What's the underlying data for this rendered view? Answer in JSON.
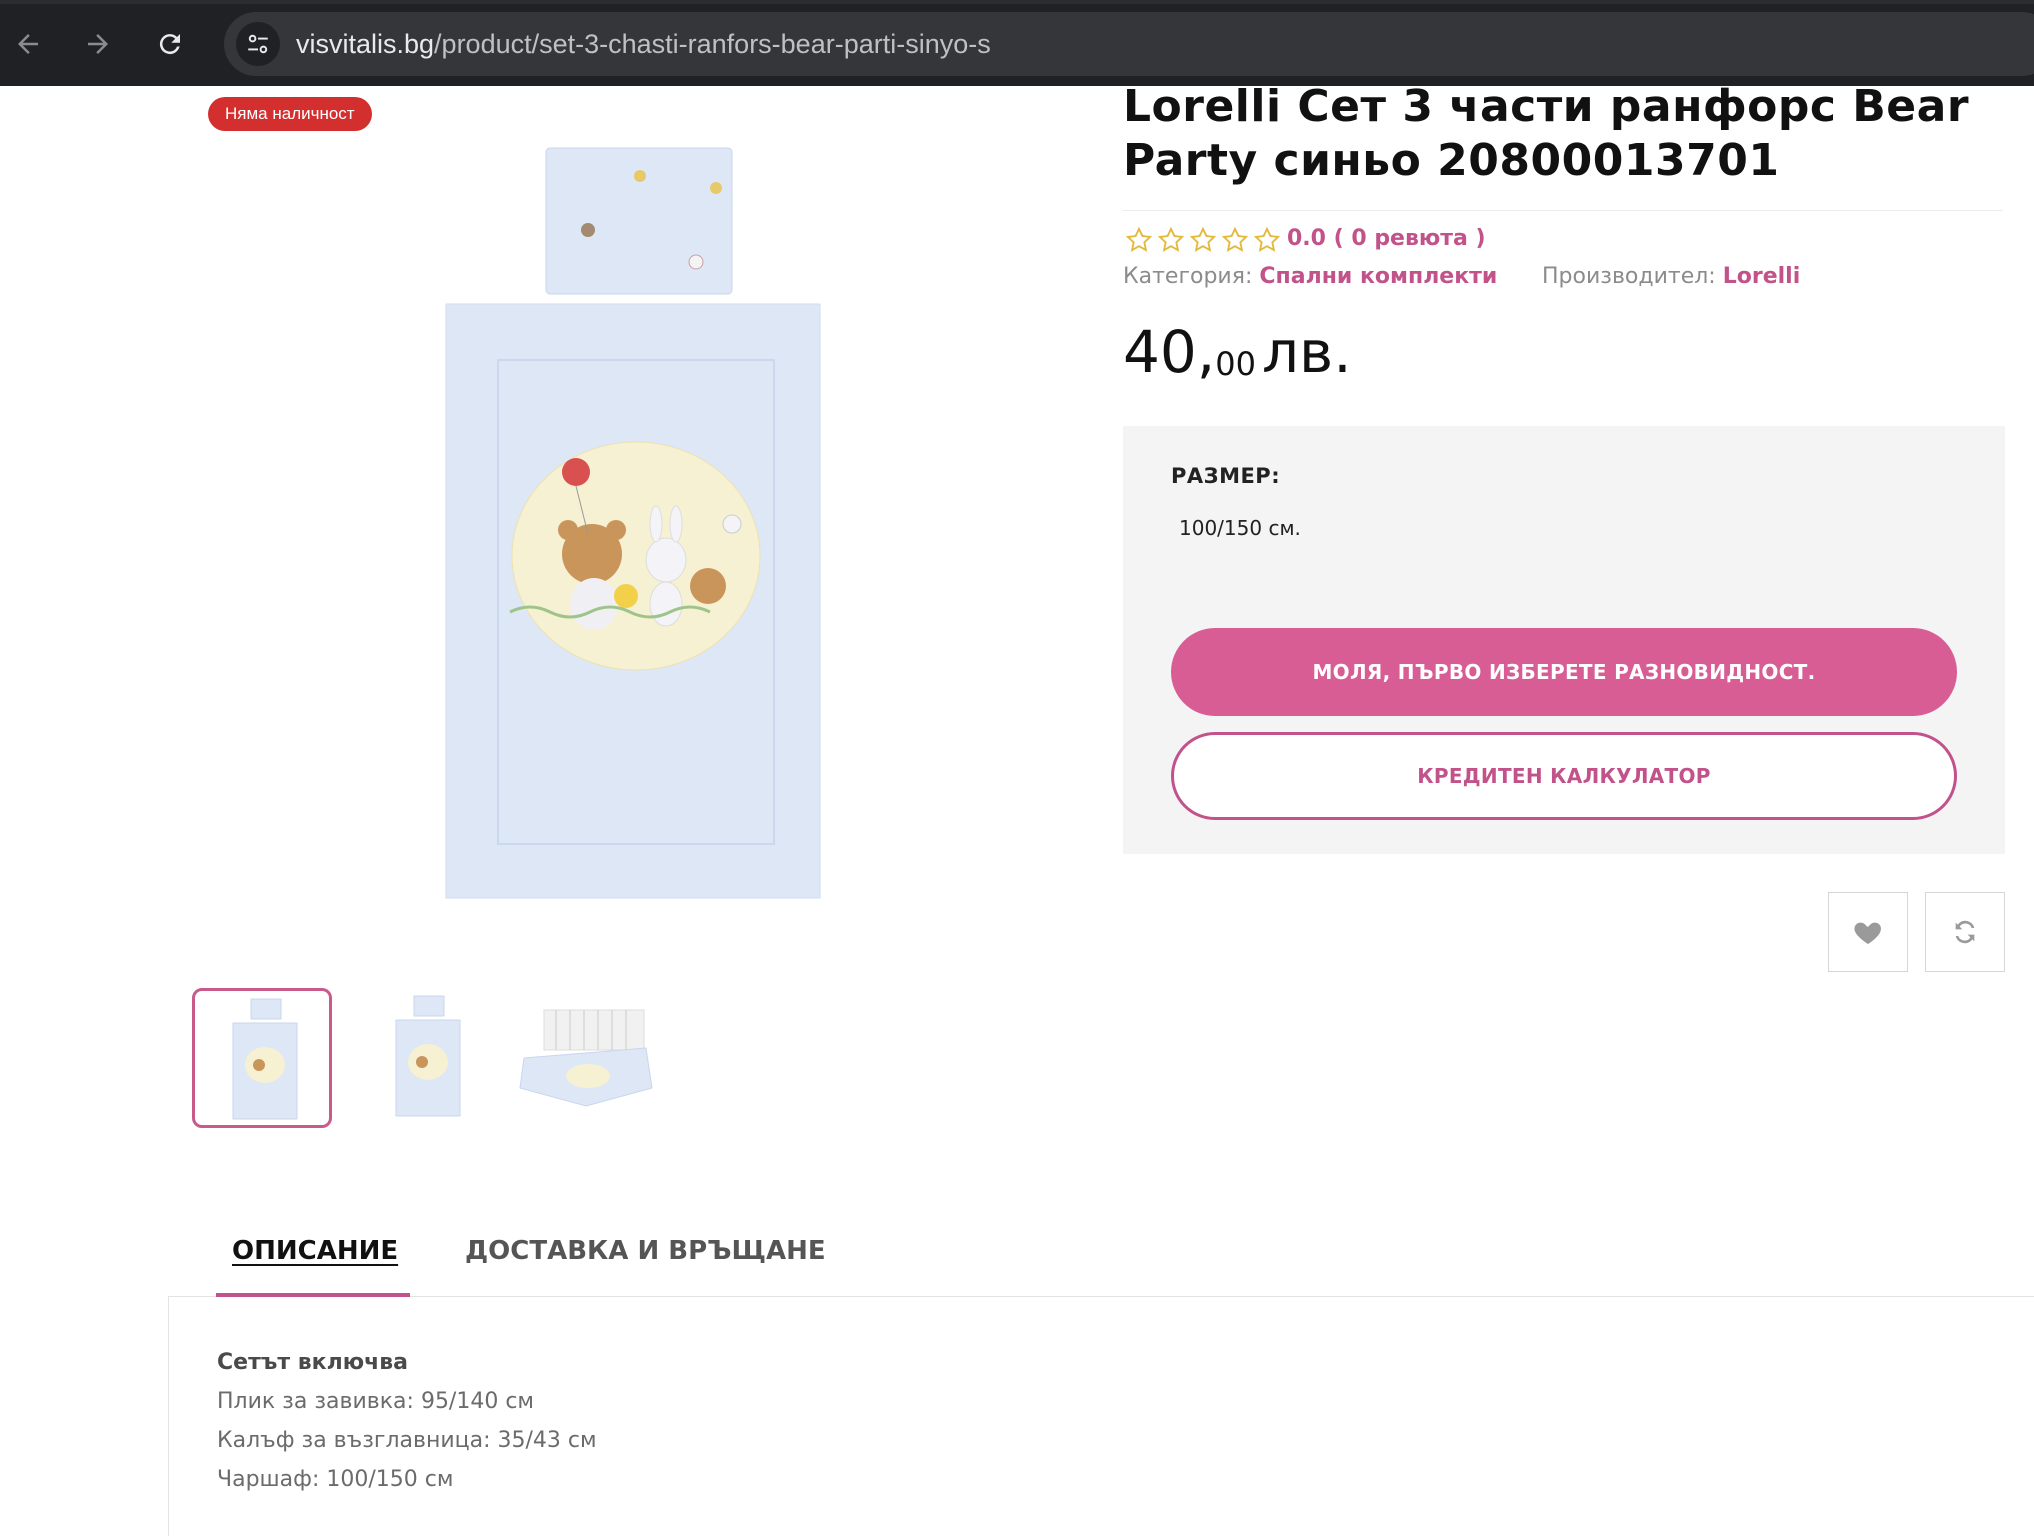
{
  "browser": {
    "url_domain": "visvitalis.bg",
    "url_path": "/product/set-3-chasti-ranfors-bear-parti-sinyo-s"
  },
  "gallery": {
    "stock_badge": "Няма наличност",
    "main_image": "product-main-image",
    "thumbnails": [
      "thumbnail-1",
      "thumbnail-2",
      "thumbnail-3"
    ]
  },
  "product": {
    "title": "Lorelli Сет 3 части ранфорс Bear Party синьо 20800013701",
    "rating": 0.0,
    "rating_text": "0.0 ( 0 ревюта )",
    "category_label": "Категория:",
    "category_value": "Спални комплекти",
    "manufacturer_label": "Производител:",
    "manufacturer_value": "Lorelli",
    "price_int": "40,",
    "price_dec": "00",
    "price_currency": "лв."
  },
  "options": {
    "size_label": "РАЗМЕР:",
    "size_value": "100/150 см.",
    "primary_button": "МОЛЯ, ПЪРВО ИЗБЕРЕТЕ РАЗНОВИДНОСТ.",
    "credit_button": "КРЕДИТЕН КАЛКУЛАТОР"
  },
  "actions": {
    "wishlist_icon": "heart-icon",
    "compare_icon": "compare-icon"
  },
  "tabs": {
    "description": "ОПИСАНИЕ",
    "shipping": "ДОСТАВКА И ВРЪЩАНЕ"
  },
  "description": {
    "heading": "Сетът включва",
    "lines": [
      "Плик за завивка: 95/140 см",
      "Калъф за възглавница: 35/43 см",
      "Чаршаф: 100/150 см"
    ]
  },
  "colors": {
    "accent": "#c2528a",
    "button_pink": "#d75d94",
    "badge_red": "#d32f2f",
    "star": "#e2b93b"
  }
}
